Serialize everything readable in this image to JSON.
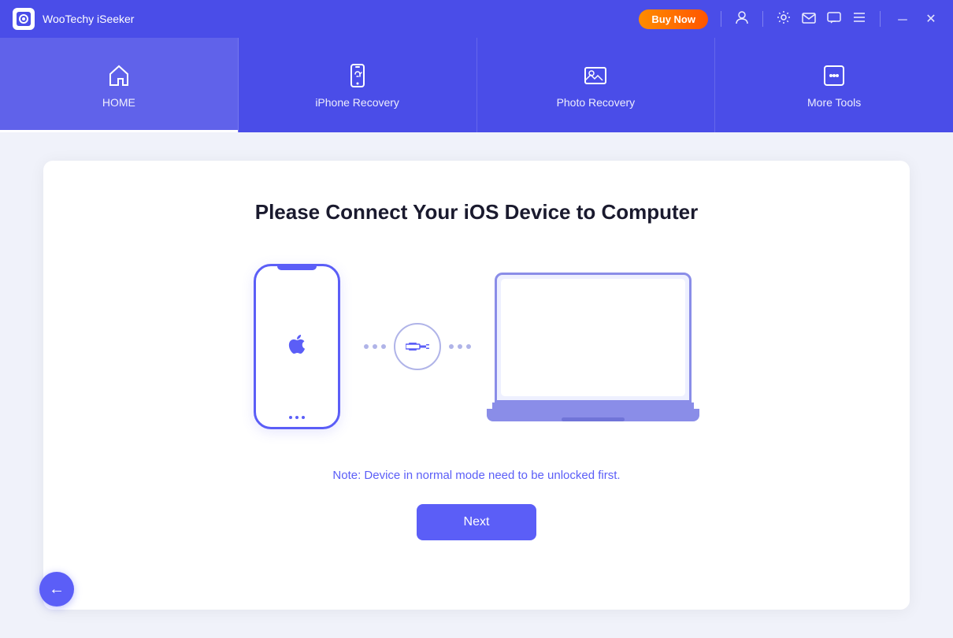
{
  "titlebar": {
    "app_name": "WooTechy iSeeker",
    "buy_btn_label": "Buy Now"
  },
  "navbar": {
    "items": [
      {
        "id": "home",
        "label": "HOME",
        "icon": "home-icon"
      },
      {
        "id": "iphone-recovery",
        "label": "iPhone Recovery",
        "icon": "iphone-recovery-icon"
      },
      {
        "id": "photo-recovery",
        "label": "Photo Recovery",
        "icon": "photo-recovery-icon"
      },
      {
        "id": "more-tools",
        "label": "More Tools",
        "icon": "more-tools-icon"
      }
    ]
  },
  "main": {
    "title": "Please Connect Your iOS Device to Computer",
    "note": "Note: Device in normal mode need to be unlocked first.",
    "next_label": "Next"
  },
  "controls": {
    "back_label": "←"
  }
}
